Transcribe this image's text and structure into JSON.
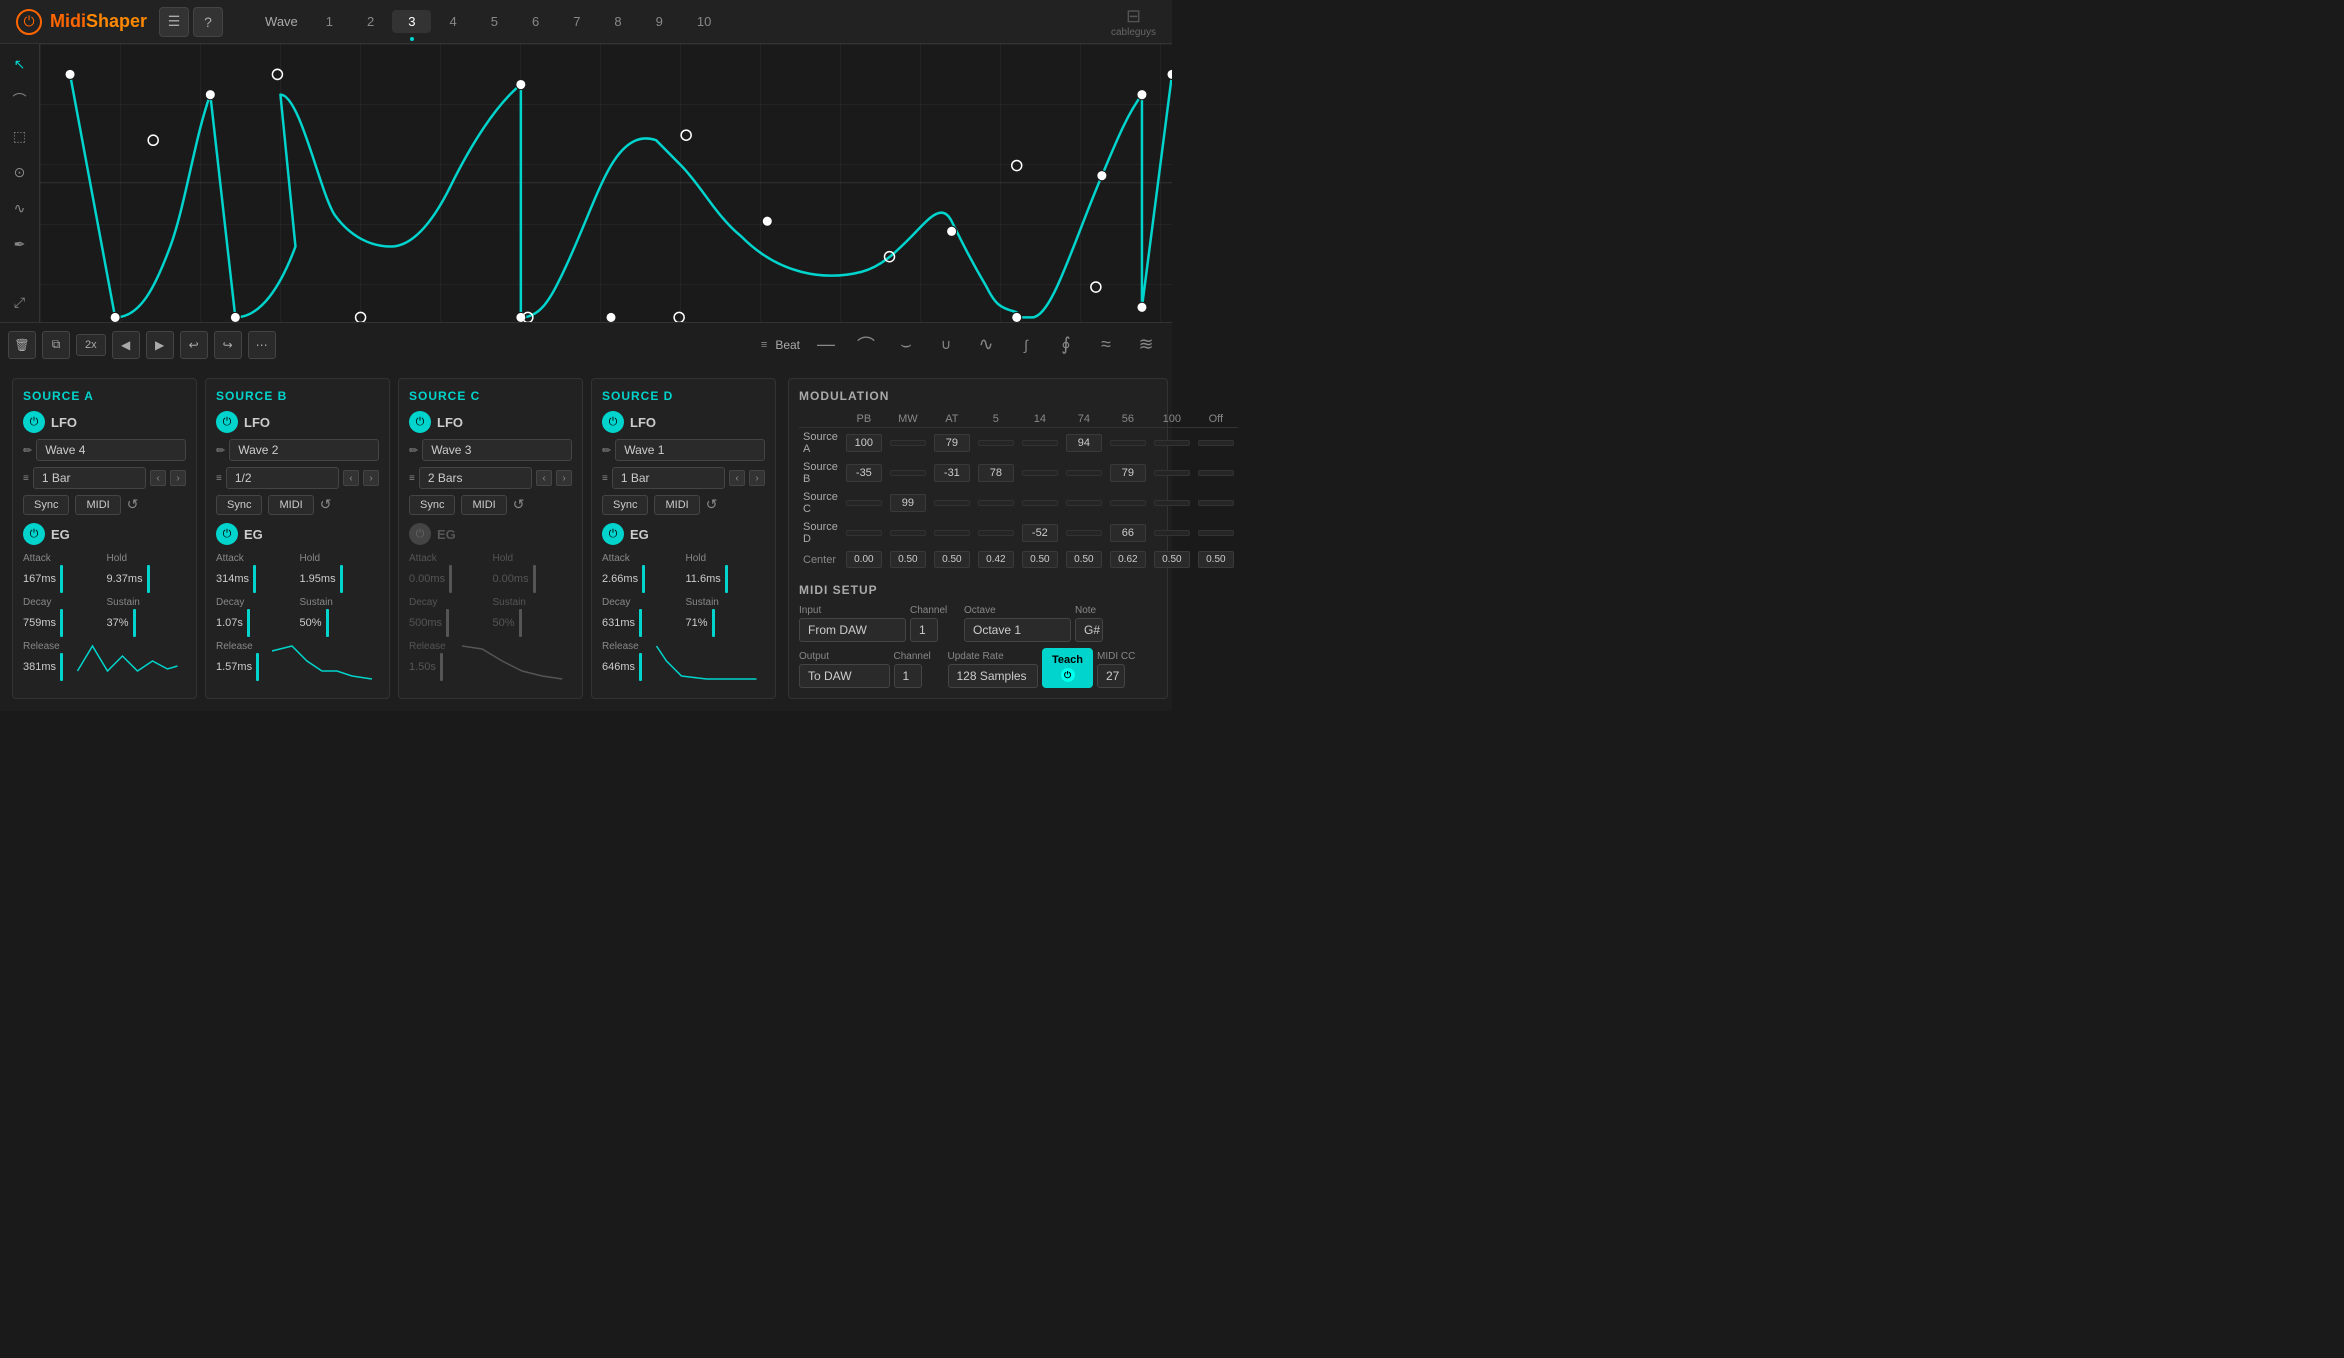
{
  "app": {
    "name": "MidiShaper",
    "name_part1": "Midi",
    "name_part2": "Shaper",
    "cableguys": "cableguys"
  },
  "header": {
    "menu_icon": "☰",
    "help_icon": "?",
    "wave_tab_label": "Wave",
    "tabs": [
      "1",
      "2",
      "3",
      "4",
      "5",
      "6",
      "7",
      "8",
      "9",
      "10"
    ],
    "active_tab": "3"
  },
  "tools": {
    "cursor": "↖",
    "curve": "⌒",
    "select": "⬚",
    "node": "◉",
    "bezier": "∿",
    "pen": "✒",
    "zoom": "⤢"
  },
  "toolbar": {
    "trash": "🗑",
    "copy": "⧉",
    "multiplier": "2x",
    "back": "◀",
    "forward": "▶",
    "undo": "↩",
    "redo": "↪",
    "more": "⋯",
    "beat_label": "Beat",
    "shapes": [
      "—",
      "⌒",
      "⌓",
      "⌣",
      "∪",
      "∿",
      "∫",
      "∮",
      "≈"
    ]
  },
  "sources": {
    "a": {
      "title": "SOURCE A",
      "lfo_label": "LFO",
      "lfo_active": true,
      "wave_name": "Wave 4",
      "bar_value": "1 Bar",
      "sync": "Sync",
      "midi": "MIDI",
      "eg_label": "EG",
      "eg_active": true,
      "attack_label": "Attack",
      "attack_value": "167ms",
      "hold_label": "Hold",
      "hold_value": "9.37ms",
      "decay_label": "Decay",
      "decay_value": "759ms",
      "sustain_label": "Sustain",
      "sustain_value": "37%",
      "release_label": "Release",
      "release_value": "381ms"
    },
    "b": {
      "title": "SOURCE B",
      "lfo_label": "LFO",
      "lfo_active": true,
      "wave_name": "Wave 2",
      "bar_value": "1/2",
      "sync": "Sync",
      "midi": "MIDI",
      "eg_label": "EG",
      "eg_active": true,
      "attack_label": "Attack",
      "attack_value": "314ms",
      "hold_label": "Hold",
      "hold_value": "1.95ms",
      "decay_label": "Decay",
      "decay_value": "1.07s",
      "sustain_label": "Sustain",
      "sustain_value": "50%",
      "release_label": "Release",
      "release_value": "1.57ms"
    },
    "c": {
      "title": "SOURCE C",
      "lfo_label": "LFO",
      "lfo_active": true,
      "wave_name": "Wave 3",
      "bar_value": "2 Bars",
      "sync": "Sync",
      "midi": "MIDI",
      "eg_label": "EG",
      "eg_active": false,
      "attack_label": "Attack",
      "attack_value": "0.00ms",
      "hold_label": "Hold",
      "hold_value": "0.00ms",
      "decay_label": "Decay",
      "decay_value": "500ms",
      "sustain_label": "Sustain",
      "sustain_value": "50%",
      "release_label": "Release",
      "release_value": "1.50s"
    },
    "d": {
      "title": "SOURCE D",
      "lfo_label": "LFO",
      "lfo_active": true,
      "wave_name": "Wave 1",
      "bar_value": "1 Bar",
      "sync": "Sync",
      "midi": "MIDI",
      "eg_label": "EG",
      "eg_active": true,
      "attack_label": "Attack",
      "attack_value": "2.66ms",
      "hold_label": "Hold",
      "hold_value": "11.6ms",
      "decay_label": "Decay",
      "decay_value": "631ms",
      "sustain_label": "Sustain",
      "sustain_value": "71%",
      "release_label": "Release",
      "release_value": "646ms"
    }
  },
  "modulation": {
    "title": "MODULATION",
    "columns": [
      "PB",
      "MW",
      "AT",
      "5",
      "14",
      "74",
      "56",
      "100",
      "Off"
    ],
    "rows": [
      {
        "label": "Source A",
        "values": {
          "PB": "100",
          "MW": "",
          "AT": "79",
          "5": "",
          "14": "",
          "74": "94",
          "56": "",
          "100": "",
          "Off": ""
        }
      },
      {
        "label": "Source B",
        "values": {
          "PB": "-35",
          "MW": "",
          "AT": "-31",
          "5": "78",
          "14": "",
          "74": "",
          "56": "79",
          "100": "",
          "Off": ""
        }
      },
      {
        "label": "Source C",
        "values": {
          "PB": "",
          "MW": "99",
          "AT": "",
          "5": "",
          "14": "",
          "74": "",
          "56": "",
          "100": "",
          "Off": ""
        }
      },
      {
        "label": "Source D",
        "values": {
          "PB": "",
          "MW": "",
          "AT": "",
          "5": "",
          "14": "-52",
          "74": "",
          "56": "66",
          "100": "",
          "Off": ""
        }
      }
    ],
    "center_label": "Center",
    "center_values": [
      "0.00",
      "0.50",
      "0.50",
      "0.42",
      "0.50",
      "0.50",
      "0.62",
      "0.50",
      "0.50"
    ]
  },
  "midi_setup": {
    "title": "MIDI SETUP",
    "input_label": "Input",
    "input_value": "From DAW",
    "input_channel_label": "Channel",
    "input_channel_value": "1",
    "octave_label": "Octave",
    "octave_value": "Octave 1",
    "note_label": "Note",
    "note_value": "G#",
    "output_label": "Output",
    "output_value": "To DAW",
    "output_channel_label": "Channel",
    "output_channel_value": "1",
    "update_rate_label": "Update Rate",
    "update_rate_value": "128 Samples",
    "teach_label": "Teach",
    "midi_cc_label": "MIDI CC",
    "midi_cc_value": "27"
  }
}
